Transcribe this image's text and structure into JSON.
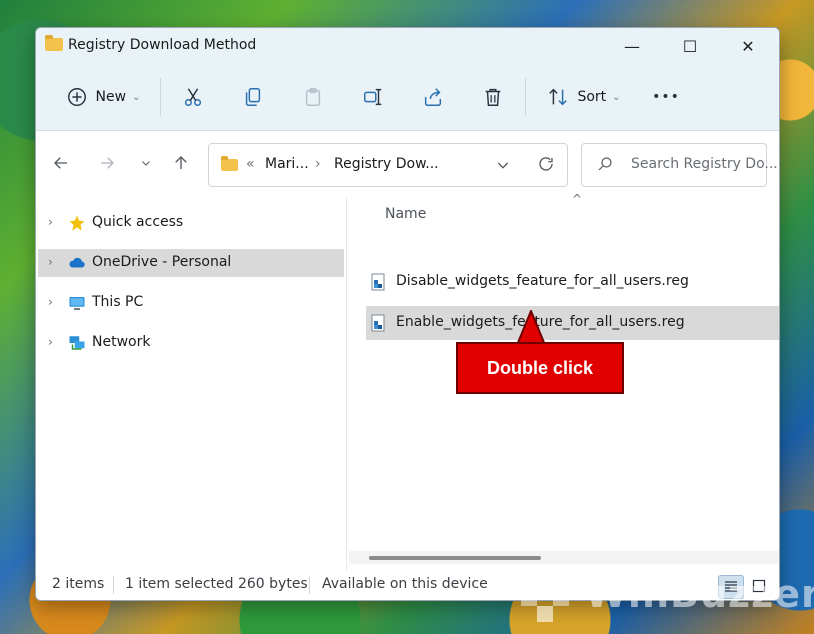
{
  "window": {
    "title": "Registry Download Method",
    "controls": {
      "minimize": "—",
      "maximize": "☐",
      "close": "✕"
    }
  },
  "toolbar": {
    "new_label": "New",
    "sort_label": "Sort",
    "more_label": "•••",
    "icons": [
      "plus-circle-icon",
      "cut-icon",
      "copy-icon",
      "paste-icon",
      "rename-icon",
      "share-icon",
      "delete-icon",
      "sort-icon"
    ]
  },
  "navigation": {
    "breadcrumb_overflow": "«",
    "breadcrumb": [
      "Mari...",
      "Registry Dow..."
    ],
    "separator": "›",
    "search_placeholder": "Search Registry Do..."
  },
  "sidebar": {
    "items": [
      {
        "label": "Quick access",
        "icon": "star-icon",
        "selected": false
      },
      {
        "label": "OneDrive - Personal",
        "icon": "cloud-icon",
        "selected": true
      },
      {
        "label": "This PC",
        "icon": "monitor-icon",
        "selected": false
      },
      {
        "label": "Network",
        "icon": "network-icon",
        "selected": false
      }
    ]
  },
  "content": {
    "column_header": "Name",
    "files": [
      {
        "name": "Disable_widgets_feature_for_all_users.reg",
        "selected": false,
        "icon": "registry-file-icon"
      },
      {
        "name": "Enable_widgets_feature_for_all_users.reg",
        "selected": true,
        "icon": "registry-file-icon"
      }
    ]
  },
  "annotation": {
    "text": "Double click",
    "color": "#e00000"
  },
  "status": {
    "items_count": "2 items",
    "selection": "1 item selected  260 bytes",
    "availability": "Available on this device"
  },
  "watermark": {
    "text": "WinBuzzer"
  },
  "colors": {
    "accent": "#e8f2f7",
    "selection": "#d9d9d9",
    "folder": "#f3c24b"
  }
}
